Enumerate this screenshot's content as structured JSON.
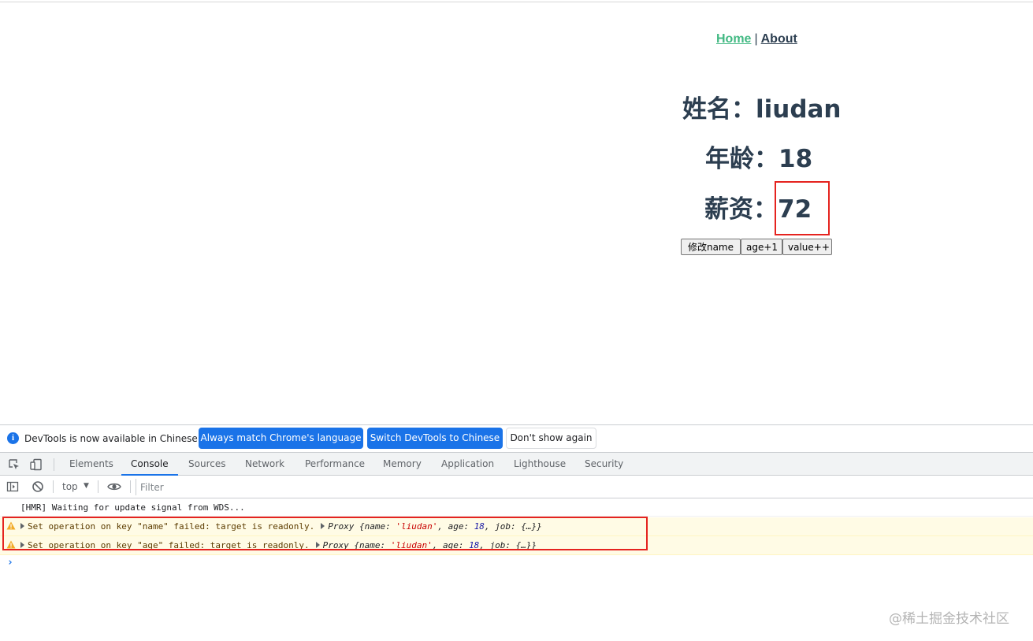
{
  "app": {
    "nav": {
      "home": "Home",
      "separator": "|",
      "about": "About"
    },
    "name_line": "姓名：liudan",
    "age_line": "年龄：18",
    "salary_label": "薪资：",
    "salary_value": "72",
    "buttons": {
      "change_name": "修改name",
      "age_plus": "age+1",
      "value_plus": "value++"
    },
    "colors": {
      "link_active": "#42b983",
      "text": "#2c3e50",
      "highlight_box": "#e5231f"
    }
  },
  "devtools": {
    "infobar": {
      "message": "DevTools is now available in Chinese!",
      "always_match": "Always match Chrome's language",
      "switch_chinese": "Switch DevTools to Chinese",
      "dont_show": "Don't show again"
    },
    "tabs": [
      "Elements",
      "Console",
      "Sources",
      "Network",
      "Performance",
      "Memory",
      "Application",
      "Lighthouse",
      "Security"
    ],
    "active_tab": "Console",
    "console_toolbar": {
      "context": "top",
      "filter_placeholder": "Filter"
    },
    "messages": {
      "log": "[HMR] Waiting for update signal from WDS...",
      "warning1": "Set operation on key \"name\" failed: target is readonly.",
      "warning2": "Set operation on key \"age\" failed: target is readonly.",
      "proxy_prefix": "Proxy {name: ",
      "proxy_name_value": "'liudan'",
      "proxy_mid": ", age: ",
      "proxy_age_value": "18",
      "proxy_suffix": ", job: {…}}"
    },
    "prompt_symbol": "›"
  },
  "watermark": "@稀土掘金技术社区"
}
